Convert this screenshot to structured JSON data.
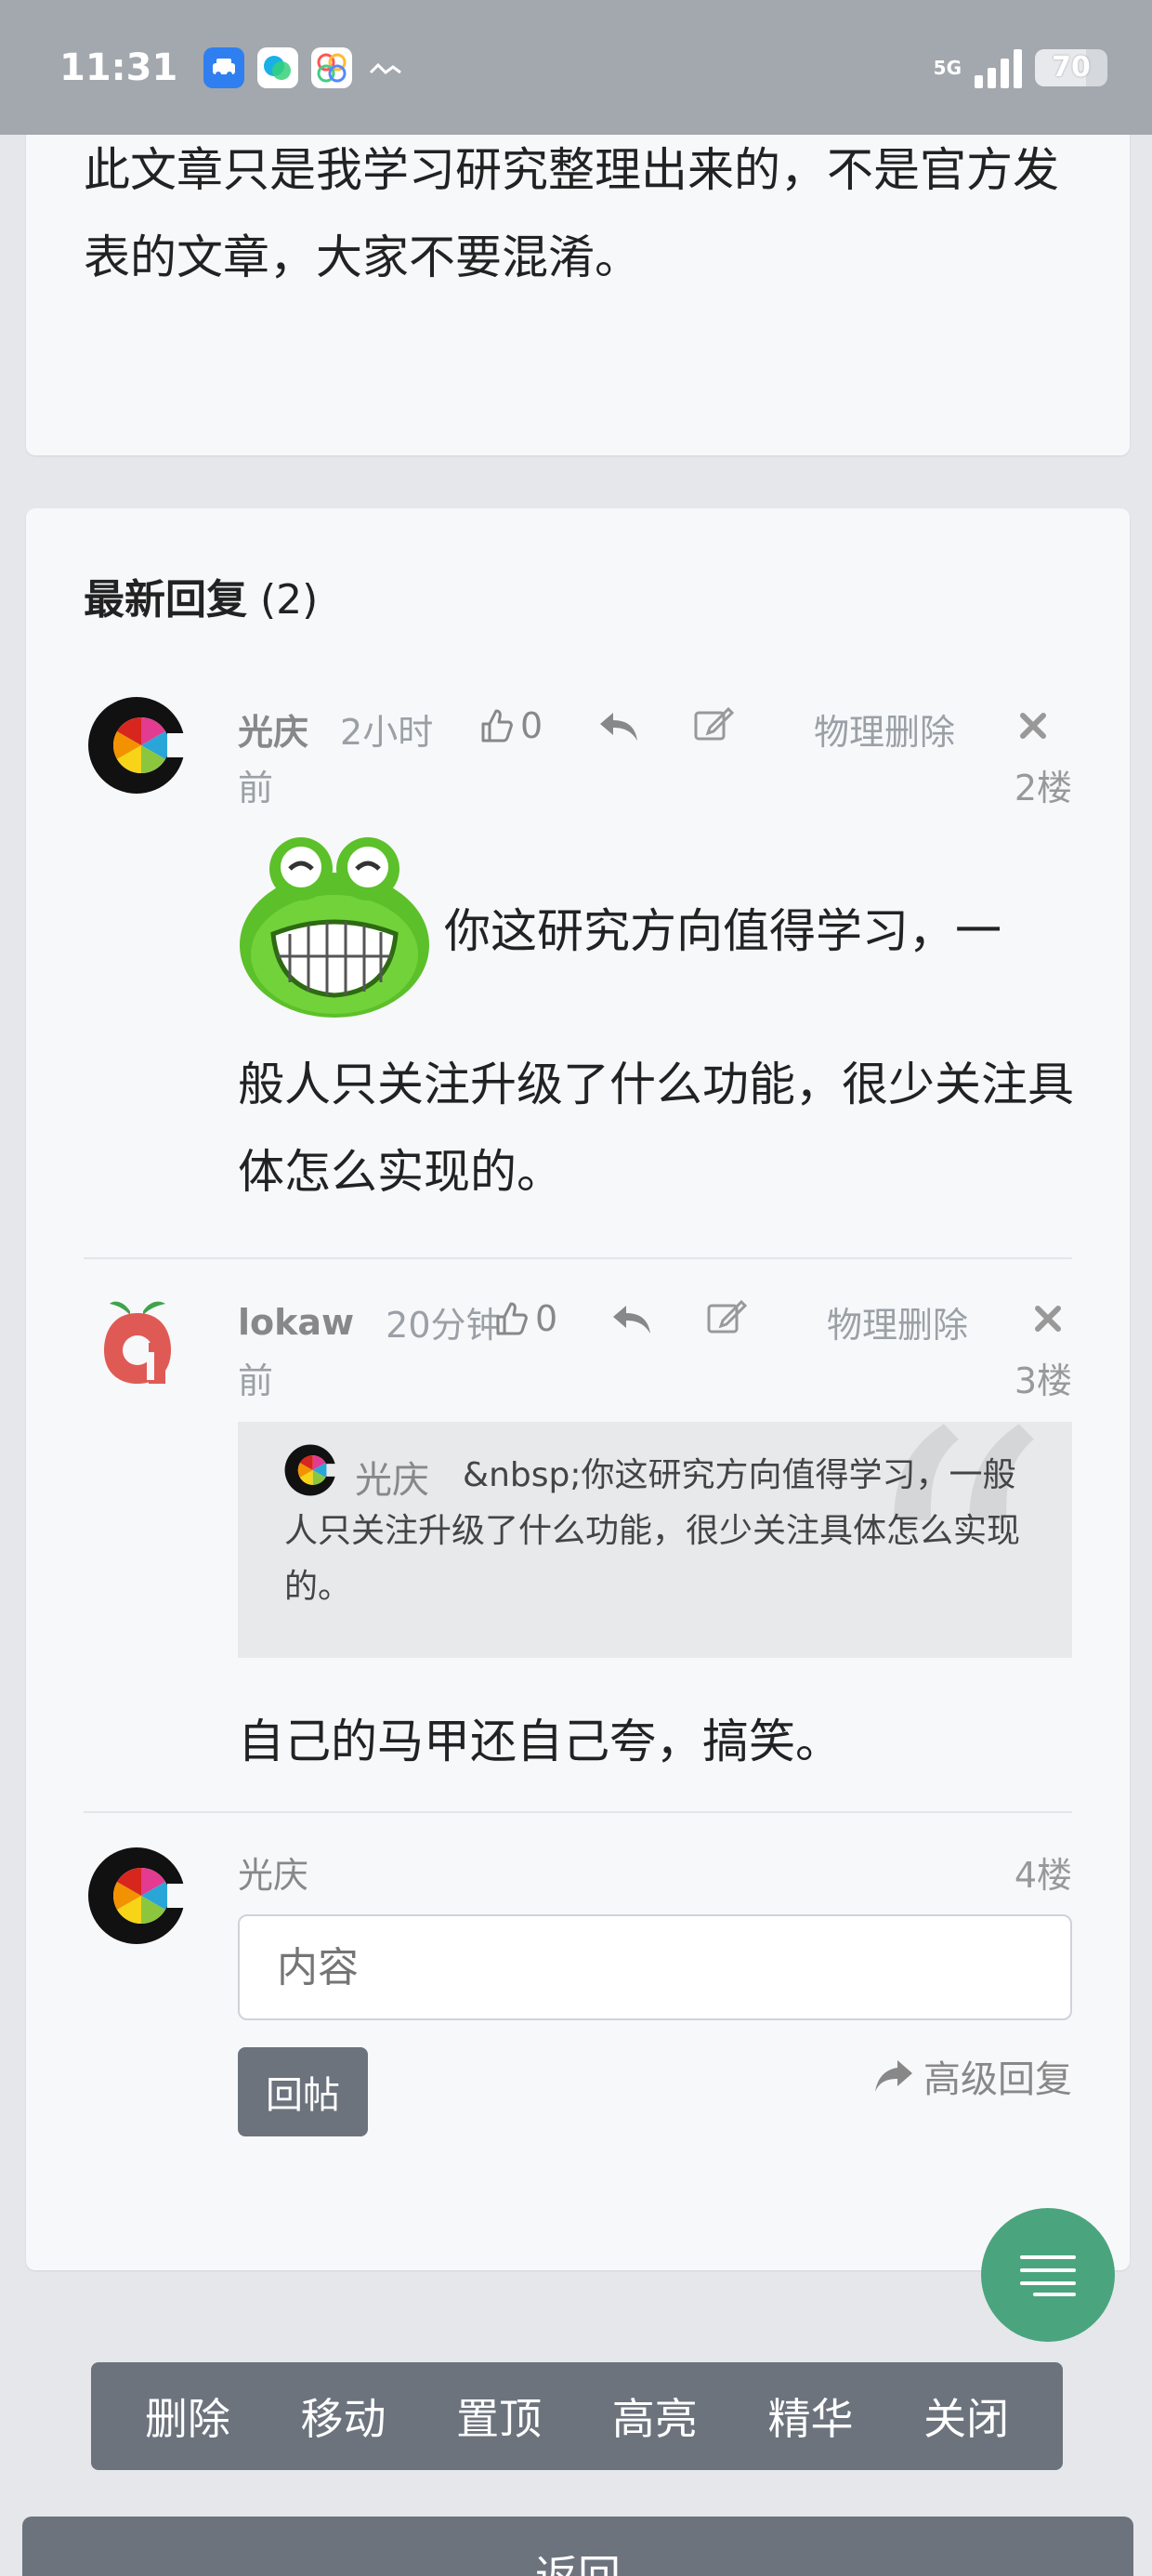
{
  "status_bar": {
    "time": "11:31",
    "network": "5G",
    "battery": "70",
    "battery_level_percent": 70,
    "icons": [
      "car-app-icon",
      "blob-app-icon",
      "photos-app-icon",
      "activity-icon",
      "signal-icon",
      "battery-icon"
    ]
  },
  "article": {
    "text": "此文章只是我学习研究整理出来的，不是官方发表的文章，大家不要混淆。"
  },
  "replies_section": {
    "title": "最新回复",
    "count": "(2)"
  },
  "replies": [
    {
      "author": "光庆",
      "time_line1": "2小时",
      "time_line2": "前",
      "likes": "0",
      "delete_label": "物理删除",
      "floor": "2楼",
      "content_line1": "你这研究方向值得学习，一",
      "content_rest": "般人只关注升级了什么功能，很少关注具体怎么实现的。",
      "emoji": "frog-grin-emoji"
    },
    {
      "author": "lokaw",
      "time_line1": "20分钟",
      "time_line2": "前",
      "likes": "0",
      "delete_label": "物理删除",
      "floor": "3楼",
      "quote_author": "光庆",
      "quote_text": "&nbsp;你这研究方向值得学习，一般人只关注升级了什么功能，很少关注具体怎么实现的。",
      "content": "自己的马甲还自己夸，搞笑。"
    }
  ],
  "reply_form": {
    "user": "光庆",
    "floor": "4楼",
    "placeholder": "内容",
    "submit_label": "回帖",
    "advanced_label": "高级回复"
  },
  "toolbar": {
    "items": [
      "删除",
      "移动",
      "置顶",
      "高亮",
      "精华",
      "关闭"
    ]
  },
  "back_label": "返回",
  "colors": {
    "accent_green": "#4aa57e",
    "toolbar_gray": "#6c737d",
    "background": "#e5e7eb"
  }
}
